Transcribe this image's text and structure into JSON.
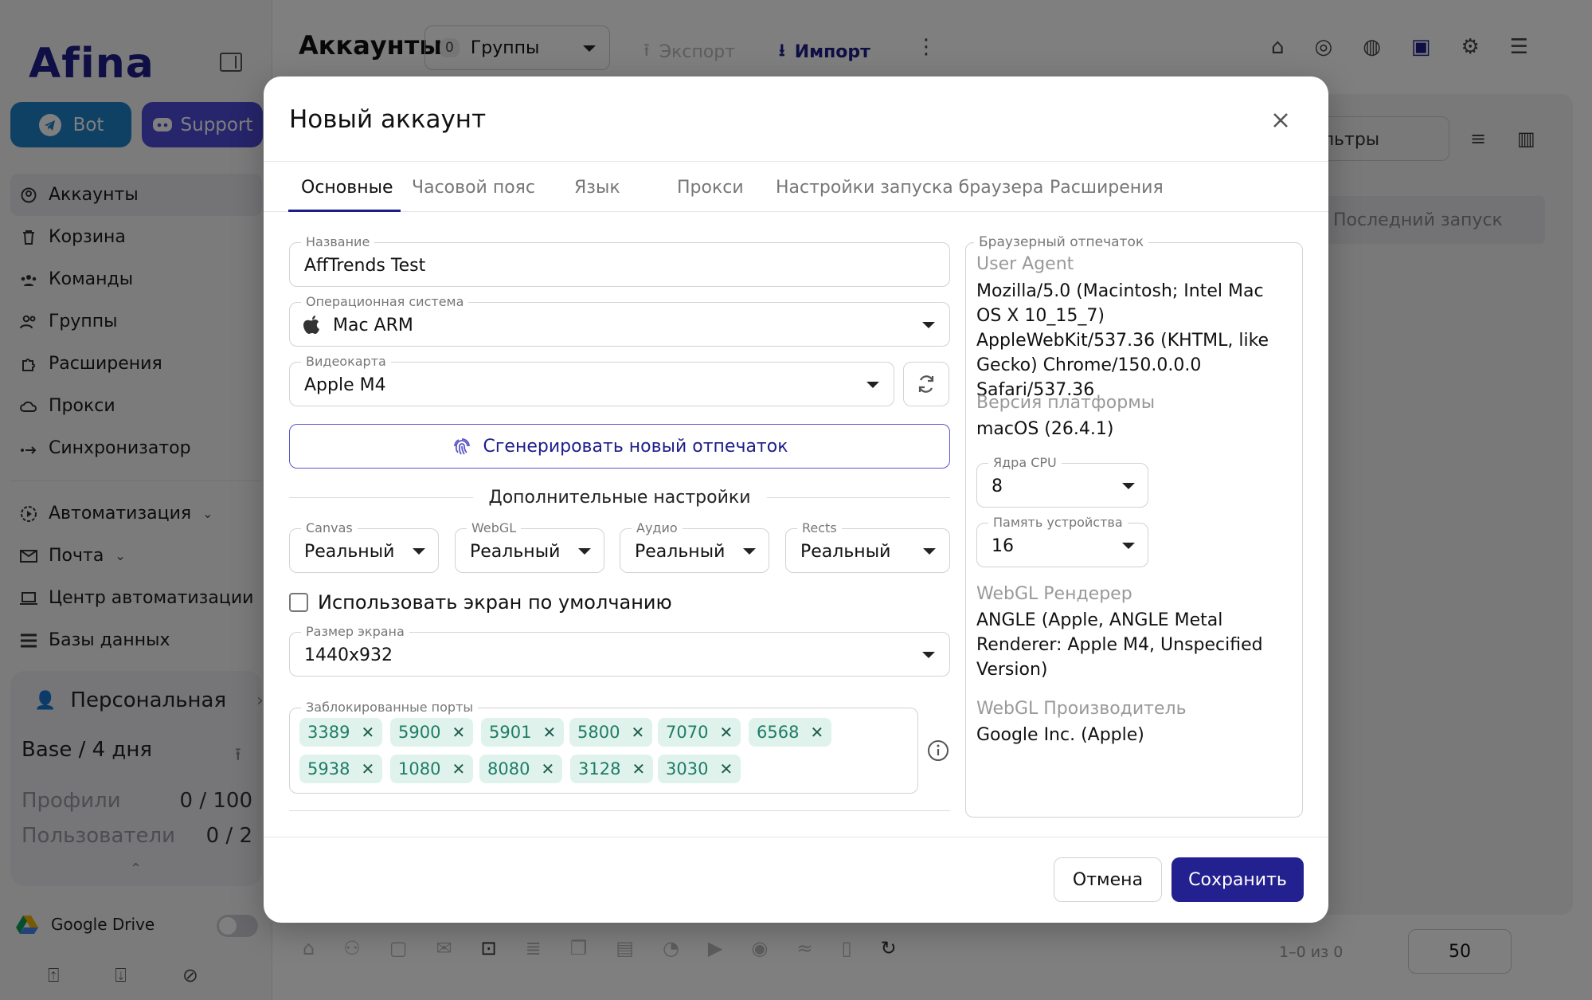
{
  "sidebar": {
    "logo": "Afina",
    "bot_label": "Bot",
    "support_label": "Support",
    "nav_items": [
      {
        "label": "Аккаунты",
        "icon": "user-circle-icon"
      },
      {
        "label": "Корзина",
        "icon": "trash-icon"
      },
      {
        "label": "Команды",
        "icon": "team-icon"
      },
      {
        "label": "Группы",
        "icon": "group-icon"
      },
      {
        "label": "Расширения",
        "icon": "puzzle-icon"
      },
      {
        "label": "Прокси",
        "icon": "cloud-icon"
      },
      {
        "label": "Синхронизатор",
        "icon": "sync-icon"
      }
    ],
    "nav_items2": [
      {
        "label": "Автоматизация",
        "icon": "automation-icon"
      },
      {
        "label": "Почта",
        "icon": "mail-icon"
      },
      {
        "label": "Центр автоматизации",
        "icon": "laptop-icon"
      },
      {
        "label": "Базы данных",
        "icon": "database-icon"
      }
    ],
    "plan": {
      "title": "Персональная",
      "name": "Base / 4 дня",
      "profiles_label": "Профили",
      "profiles_value": "0 / 100",
      "users_label": "Пользователи",
      "users_value": "0 / 2"
    },
    "gdrive_label": "Google Drive"
  },
  "header": {
    "title": "Аккаунты",
    "groups_count": "0",
    "groups_label": "Группы",
    "export_label": "Экспорт",
    "import_label": "Импорт"
  },
  "background": {
    "filter_label": "льтры",
    "last_launch_label": "Последний запуск",
    "pagination": "1–0 из 0",
    "per_page": "50"
  },
  "modal": {
    "title": "Новый аккаунт",
    "tabs": [
      "Основные",
      "Часовой пояс",
      "Язык",
      "Прокси",
      "Настройки запуска браузера",
      "Расширения"
    ],
    "name_label": "Название",
    "name_value": "AffTrends Test",
    "os_label": "Операционная система",
    "os_value": "Mac ARM",
    "gpu_label": "Видеокарта",
    "gpu_value": "Apple M4",
    "generate_label": "Сгенерировать новый отпечаток",
    "extra_label": "Дополнительные настройки",
    "canvas_label": "Canvas",
    "canvas_value": "Реальный",
    "webgl_label": "WebGL",
    "webgl_value": "Реальный",
    "audio_label": "Аудио",
    "audio_value": "Реальный",
    "rects_label": "Rects",
    "rects_value": "Реальный",
    "default_screen_label": "Использовать экран по умолчанию",
    "screen_label": "Размер экрана",
    "screen_value": "1440x932",
    "ports_label": "Заблокированные порты",
    "ports": [
      "3389",
      "5900",
      "5901",
      "5800",
      "7070",
      "6568",
      "5938",
      "1080",
      "8080",
      "3128",
      "3030"
    ],
    "fingerprint": {
      "label": "Браузерный отпечаток",
      "ua_label": "User Agent",
      "ua_value": "Mozilla/5.0 (Macintosh; Intel Mac OS X 10_15_7) AppleWebKit/537.36 (KHTML, like Gecko) Chrome/150.0.0.0 Safari/537.36",
      "platform_label": "Версия платформы",
      "platform_value": "macOS (26.4.1)",
      "cpu_label": "Ядра CPU",
      "cpu_value": "8",
      "memory_label": "Память устройства",
      "memory_value": "16",
      "renderer_label": "WebGL Рендерер",
      "renderer_value": "ANGLE (Apple, ANGLE Metal Renderer: Apple M4, Unspecified Version)",
      "vendor_label": "WebGL Производитель",
      "vendor_value": "Google Inc. (Apple)"
    },
    "cancel_label": "Отмена",
    "save_label": "Сохранить"
  },
  "colors": {
    "brand": "#1e1d8a",
    "bot": "#1f82c9",
    "support": "#4f4ad6",
    "chip_bg": "#dff3ec",
    "chip_text": "#1f7c66"
  }
}
